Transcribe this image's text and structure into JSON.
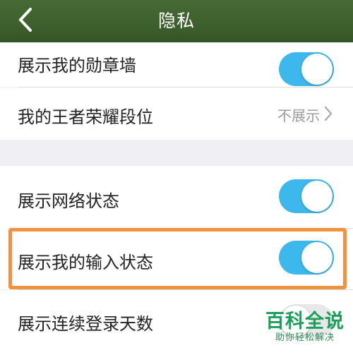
{
  "header": {
    "title": "隐私",
    "back_icon": "chevron-left-icon",
    "background_color": "#3e612e"
  },
  "settings": {
    "group1": [
      {
        "label": "展示我的勋章墙",
        "control": "toggle",
        "state": "on"
      },
      {
        "label": "我的王者荣耀段位",
        "control": "value",
        "value": "不展示",
        "icon": "chevron-right-icon"
      }
    ],
    "group2": [
      {
        "label": "展示网络状态",
        "control": "toggle",
        "state": "on"
      },
      {
        "label": "展示我的输入状态",
        "control": "toggle",
        "state": "on",
        "highlighted": true
      },
      {
        "label": "展示连续登录天数",
        "control": "toggle",
        "state": "off"
      }
    ]
  },
  "colors": {
    "toggle_on": "#3cb8ec",
    "highlight": "#f0923e",
    "page_background": "#efeff4"
  },
  "watermark": {
    "main": "百科全说",
    "sub": "助你轻松解决"
  }
}
